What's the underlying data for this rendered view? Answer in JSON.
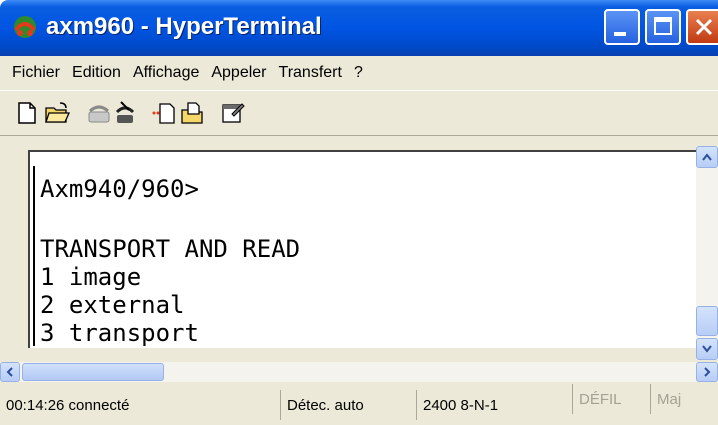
{
  "window": {
    "title": "axm960 - HyperTerminal"
  },
  "menu": {
    "items": [
      "Fichier",
      "Edition",
      "Affichage",
      "Appeler",
      "Transfert",
      "?"
    ]
  },
  "toolbar": {
    "icons": [
      "new-document-icon",
      "open-folder-icon",
      "phone-icon",
      "disconnect-icon",
      "send-icon",
      "receive-icon",
      "properties-icon"
    ]
  },
  "terminal": {
    "lines": [
      "Axm940/960>",
      "",
      "TRANSPORT AND READ",
      "1 image",
      "2 external",
      "3 transport"
    ]
  },
  "status": {
    "connection": "00:14:26 connecté",
    "detect": "Détec. auto",
    "settings": "2400 8-N-1",
    "scroll_lock": "DÉFIL",
    "caps": "Maj"
  },
  "colors": {
    "titlebar": "#0054e3",
    "chrome": "#ece9d8",
    "close": "#c13a14"
  }
}
